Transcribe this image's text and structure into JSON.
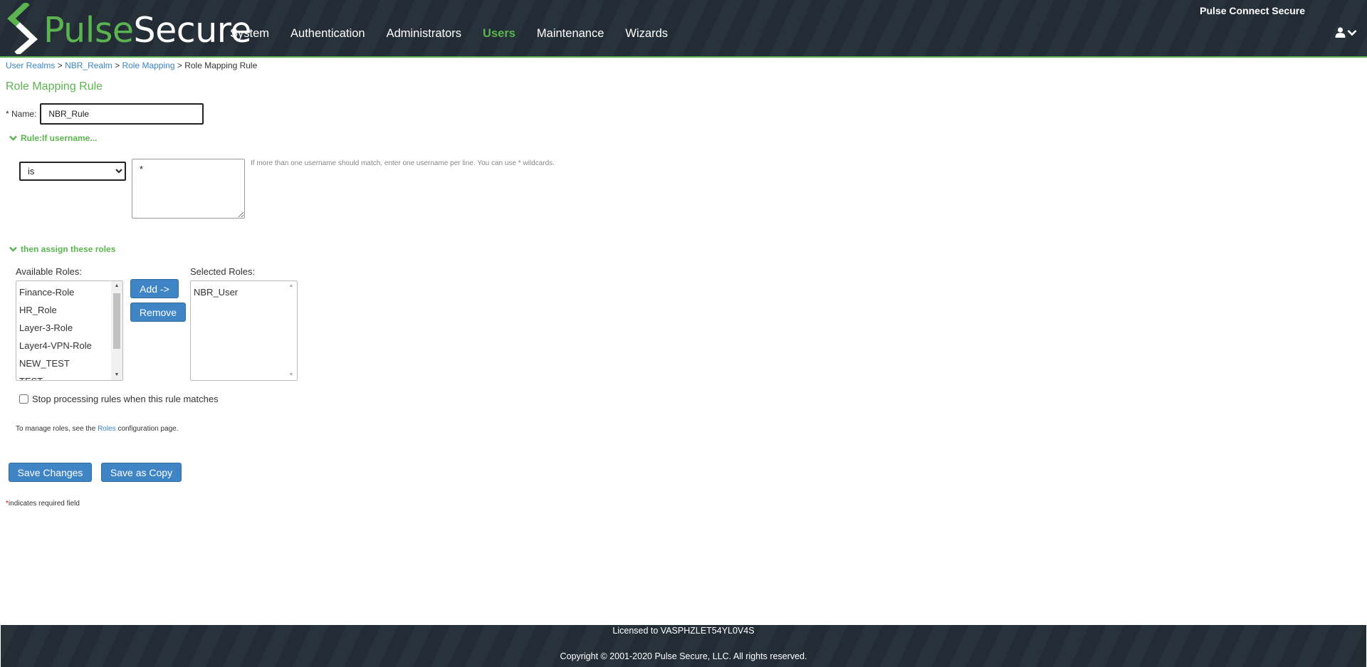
{
  "brand": {
    "logo_word1": "Pulse",
    "logo_word2": "Secure",
    "product_name": "Pulse Connect Secure",
    "accent_color": "#5bb450",
    "header_color": "#242e37",
    "link_color": "#3a84c4",
    "button_color": "#3f85c6"
  },
  "nav": {
    "items": [
      {
        "label": "System",
        "active": false
      },
      {
        "label": "Authentication",
        "active": false
      },
      {
        "label": "Administrators",
        "active": false
      },
      {
        "label": "Users",
        "active": true
      },
      {
        "label": "Maintenance",
        "active": false
      },
      {
        "label": "Wizards",
        "active": false
      }
    ],
    "user_icon": "user-icon",
    "dropdown_icon": "chevron-down-icon"
  },
  "breadcrumb": {
    "items": [
      "User Realms",
      "NBR_Realm",
      "Role Mapping"
    ],
    "current": "Role Mapping Rule",
    "separator": ">"
  },
  "page": {
    "title": "Role Mapping Rule"
  },
  "form": {
    "name_label": "* Name:",
    "name_value": "NBR_Rule",
    "rule_section_label": "Rule:If username...",
    "operator_value": "is",
    "username_value": "*",
    "hint": "If more than one username should match, enter one username per line. You can use * wildcards.",
    "assign_section_label": "then assign these roles",
    "available_roles_label": "Available Roles:",
    "available_roles": [
      "Finance-Role",
      "HR_Role",
      "Layer-3-Role",
      "Layer4-VPN-Role",
      "NEW_TEST",
      "TEST"
    ],
    "selected_roles_label": "Selected Roles:",
    "selected_roles": [
      "NBR_User"
    ],
    "add_button": "Add ->",
    "remove_button": "Remove",
    "stop_processing_label": "Stop processing rules when this rule matches",
    "stop_processing_checked": false,
    "manage_note_before": "To manage roles, see the",
    "manage_note_link": "Roles",
    "manage_note_after": "configuration page.",
    "save_button": "Save Changes",
    "save_copy_button": "Save as Copy",
    "required_star": "*",
    "required_note": "indicates required field"
  },
  "footer": {
    "license": "Licensed to VASPHZLET54YL0V4S",
    "copyright": "Copyright © 2001-2020 Pulse Secure, LLC. All rights reserved."
  }
}
